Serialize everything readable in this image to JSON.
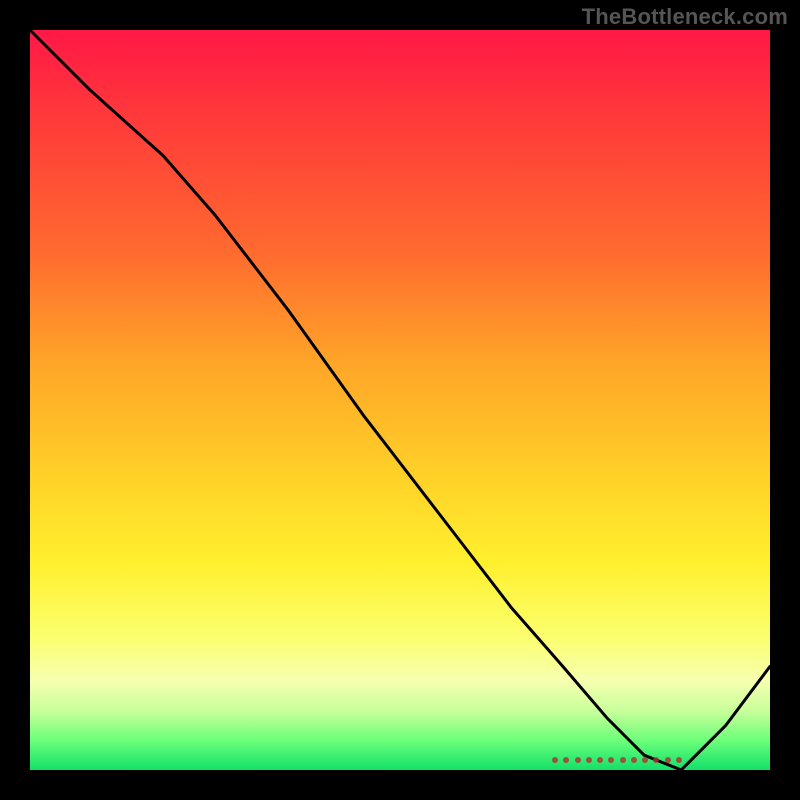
{
  "watermark": "TheBottleneck.com",
  "chart_data": {
    "type": "line",
    "title": "",
    "xlabel": "",
    "ylabel": "",
    "xlim": [
      0,
      100
    ],
    "ylim": [
      0,
      100
    ],
    "grid": false,
    "background_gradient": {
      "top": "#ff1846",
      "mid_upper": "#ffa528",
      "mid_lower": "#fff02e",
      "bottom": "#12e06a"
    },
    "series": [
      {
        "name": "curve",
        "color": "#000000",
        "x": [
          0,
          8,
          18,
          25,
          35,
          45,
          55,
          65,
          72,
          78,
          83,
          88,
          94,
          100
        ],
        "y": [
          100,
          92,
          83,
          75,
          62,
          48,
          35,
          22,
          14,
          7,
          2,
          0,
          6,
          14
        ]
      }
    ],
    "markers": {
      "name": "floor-markers",
      "color": "#b03030",
      "count": 12,
      "x_start": 73,
      "x_end": 88,
      "y": 0
    }
  }
}
